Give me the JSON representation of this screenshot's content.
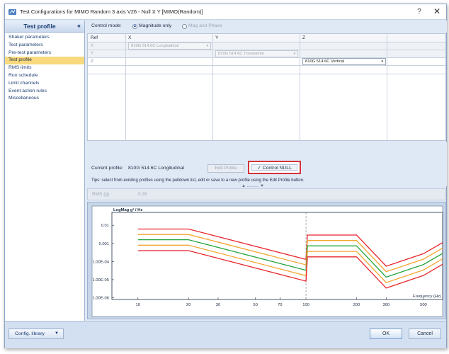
{
  "window": {
    "title": "Test Configurations for MIMO Random 3 axis V26 - Null X Y [MIMO(Random)]",
    "help_label": "?",
    "close_label": "✕"
  },
  "sidebar": {
    "title": "Test profile",
    "collapse_label": "«",
    "active_index": 3,
    "items": [
      {
        "label": "Shaker parameters"
      },
      {
        "label": "Test parameters"
      },
      {
        "label": "Pre-test parameters"
      },
      {
        "label": "Test profile"
      },
      {
        "label": "RMS limits"
      },
      {
        "label": "Run schedule"
      },
      {
        "label": "Limit channels"
      },
      {
        "label": "Event action rules"
      },
      {
        "label": "Miscellaneous"
      }
    ]
  },
  "control_mode": {
    "label": "Control mode:",
    "options": [
      {
        "label": "Magnitude only",
        "selected": true
      },
      {
        "label": "Mag and Phase",
        "selected": false
      }
    ]
  },
  "profile_grid": {
    "headers": [
      "Ref",
      "X",
      "Y",
      "Z"
    ],
    "rows": [
      {
        "ref": "X",
        "cells": [
          "810G 514.6C Longitudinal",
          "",
          ""
        ]
      },
      {
        "ref": "Y",
        "cells": [
          "",
          "810G 514.6C Transverse",
          ""
        ]
      },
      {
        "ref": "Z",
        "cells": [
          "",
          "",
          "810G 514.6C Vertical"
        ]
      }
    ]
  },
  "profile_bar": {
    "current_label": "Current profile:",
    "current_value": "810G 514.6C Longitudinal",
    "edit_label": "Edit Profile",
    "null_label": "✓ Control NULL",
    "tips": "Tips: select from existing profiles using the pulldown list, edit or save to a new profile using the Edit Profile button.",
    "splitter_label": "▲ .......... ▼"
  },
  "rms": {
    "label": "RMS (g)",
    "value": "0.35"
  },
  "chart_data": {
    "type": "line",
    "title": "LogMag g² / Hz",
    "xlabel": "Frequency (Hz)",
    "ylabel": "",
    "xscale": "log",
    "yscale": "log",
    "xlim": [
      7,
      650
    ],
    "ylim": [
      8e-07,
      0.03
    ],
    "x_ticks": [
      {
        "v": 10,
        "label": "10"
      },
      {
        "v": 20,
        "label": "20"
      },
      {
        "v": 30,
        "label": "30"
      },
      {
        "v": 50,
        "label": "50"
      },
      {
        "v": 70,
        "label": "70"
      },
      {
        "v": 100,
        "label": "100"
      },
      {
        "v": 200,
        "label": "200"
      },
      {
        "v": 300,
        "label": "300"
      },
      {
        "v": 500,
        "label": "500"
      }
    ],
    "y_ticks": [
      {
        "v": 0.01,
        "label": "0.01"
      },
      {
        "v": 0.001,
        "label": "0.001"
      },
      {
        "v": 0.0001,
        "label": "1.00E-04"
      },
      {
        "v": 1e-05,
        "label": "1.00E-05"
      },
      {
        "v": 1e-06,
        "label": "1.00E-06"
      }
    ],
    "grid": false,
    "markers_x": [
      100
    ],
    "series": [
      {
        "color": "#e8252c",
        "points": [
          [
            10,
            0.0062
          ],
          [
            20,
            0.0062
          ],
          [
            100,
            0.00013
          ],
          [
            102,
            0.0029
          ],
          [
            200,
            0.0029
          ],
          [
            300,
            5.5e-05
          ],
          [
            500,
            0.00027
          ],
          [
            650,
            0.0011
          ]
        ]
      },
      {
        "color": "#f3a632",
        "points": [
          [
            10,
            0.0031
          ],
          [
            20,
            0.0031
          ],
          [
            100,
            6.5e-05
          ],
          [
            102,
            0.00145
          ],
          [
            200,
            0.00145
          ],
          [
            300,
            2.75e-05
          ],
          [
            500,
            0.000135
          ],
          [
            650,
            0.00055
          ]
        ]
      },
      {
        "color": "#23a33c",
        "points": [
          [
            10,
            0.0016
          ],
          [
            20,
            0.0016
          ],
          [
            100,
            3.3e-05
          ],
          [
            102,
            0.00073
          ],
          [
            200,
            0.00073
          ],
          [
            300,
            1.38e-05
          ],
          [
            500,
            6.8e-05
          ],
          [
            650,
            0.00028
          ]
        ]
      },
      {
        "color": "#f3a632",
        "points": [
          [
            10,
            0.0008
          ],
          [
            20,
            0.0008
          ],
          [
            100,
            1.65e-05
          ],
          [
            102,
            0.00036
          ],
          [
            200,
            0.00036
          ],
          [
            300,
            6.9e-06
          ],
          [
            500,
            3.4e-05
          ],
          [
            650,
            0.00014
          ]
        ]
      },
      {
        "color": "#e8252c",
        "points": [
          [
            10,
            0.0004
          ],
          [
            20,
            0.0004
          ],
          [
            100,
            8.2e-06
          ],
          [
            102,
            0.00018
          ],
          [
            200,
            0.00018
          ],
          [
            300,
            3.4e-06
          ],
          [
            500,
            1.7e-05
          ],
          [
            650,
            7e-05
          ]
        ]
      }
    ]
  },
  "footer": {
    "config_label": "Config. library",
    "config_arrow": "▼",
    "ok_label": "OK",
    "cancel_label": "Cancel"
  },
  "colors": {
    "highlight": "#f8d97d",
    "accent_red": "#d6333a",
    "panel_bg": "#dfe8f5"
  }
}
